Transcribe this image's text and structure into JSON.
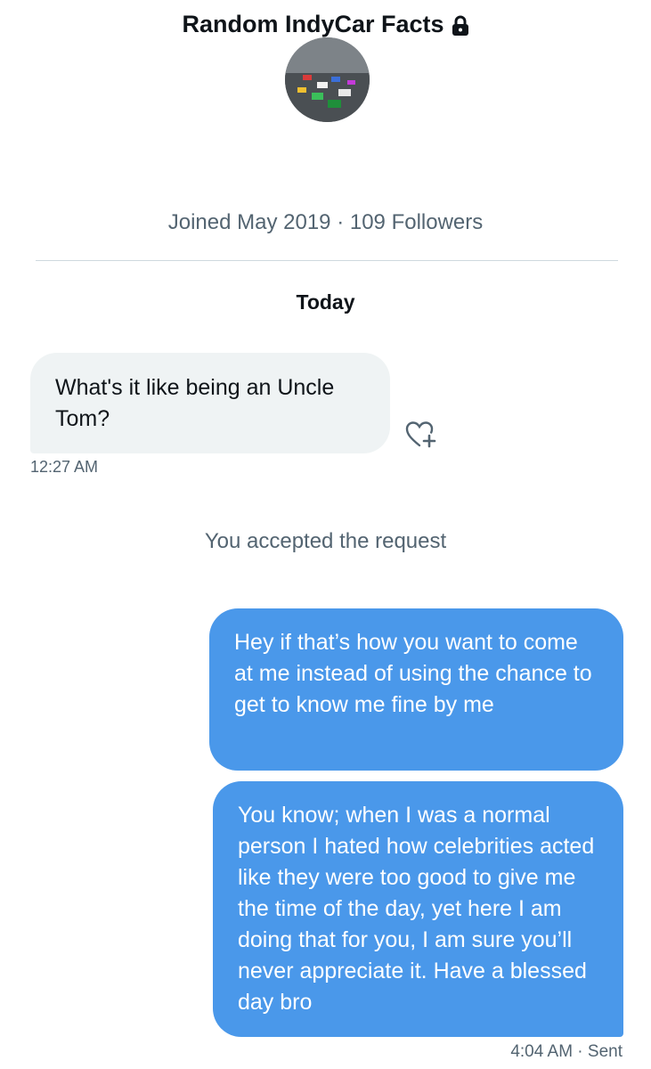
{
  "header": {
    "title": "Random IndyCar Facts",
    "lock_icon": "lock-icon"
  },
  "profile": {
    "joined_text": "Joined May 2019 · 109 Followers"
  },
  "conversation": {
    "day_label": "Today",
    "incoming": {
      "text": "What's it like being an Uncle Tom?",
      "time": "12:27 AM",
      "react_icon": "heart-plus-icon"
    },
    "system_message": "You accepted the request",
    "outgoing": [
      {
        "text": "Hey if that’s how you want to come at me instead of using the chance to get to know me fine by me"
      },
      {
        "text": "You know; when I was a normal person I hated how celebrities acted like they were too good to give me the time of the day, yet here I am doing that for you, I am sure you’ll never appreciate it. Have a blessed day bro"
      }
    ],
    "outgoing_status": "4:04 AM · Sent"
  },
  "colors": {
    "outgoing_bubble": "#4a98ea",
    "incoming_bubble": "#eff3f4",
    "secondary_text": "#536471"
  }
}
